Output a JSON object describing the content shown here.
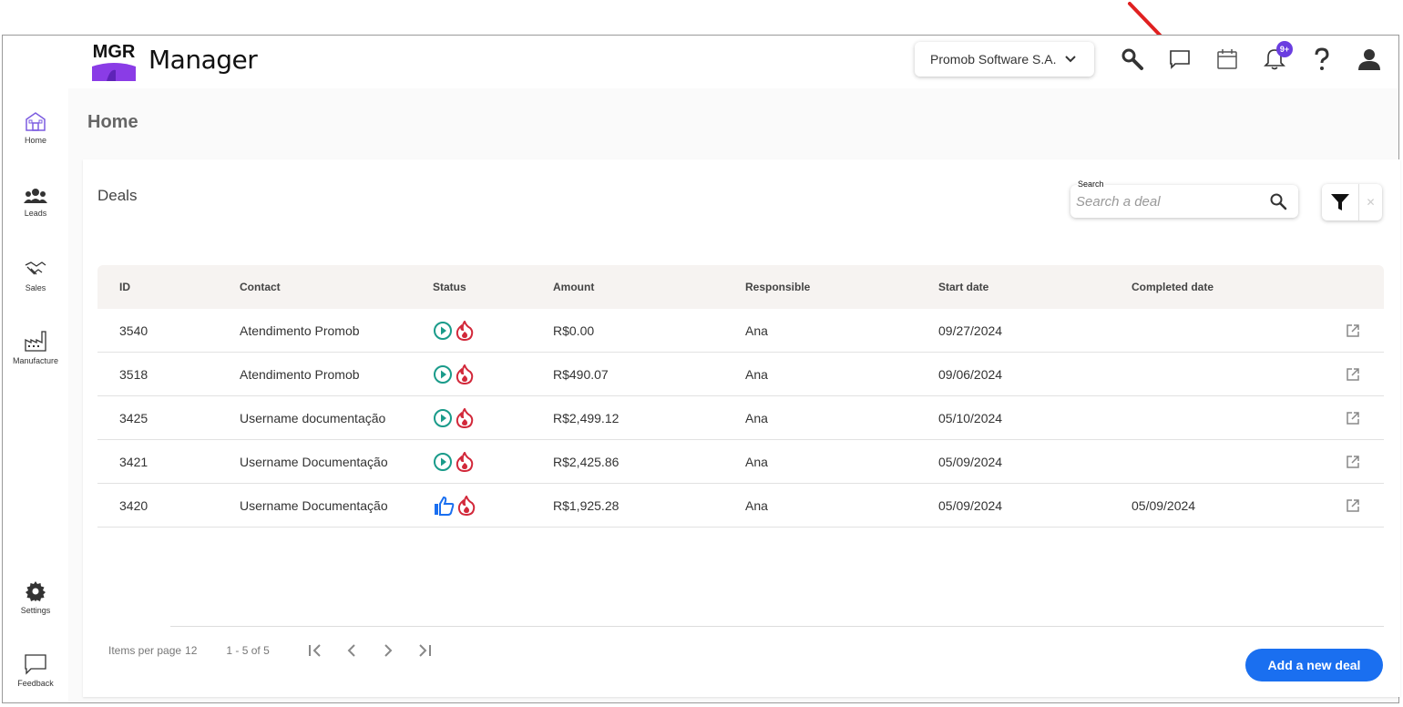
{
  "app": {
    "logo_text": "MGR",
    "name": "Manager"
  },
  "header": {
    "company": "Promob Software S.A.",
    "notifications_badge": "9+"
  },
  "sidebar": {
    "items": [
      {
        "label": "Home",
        "icon": "home-icon"
      },
      {
        "label": "Leads",
        "icon": "people-icon"
      },
      {
        "label": "Sales",
        "icon": "handshake-icon"
      },
      {
        "label": "Manufacture",
        "icon": "factory-icon"
      },
      {
        "label": "Settings",
        "icon": "gear-icon"
      },
      {
        "label": "Feedback",
        "icon": "chat-icon"
      }
    ]
  },
  "page": {
    "title": "Home"
  },
  "deals": {
    "title": "Deals",
    "search": {
      "label": "Search",
      "placeholder": "Search a deal"
    },
    "columns": {
      "id": "ID",
      "contact": "Contact",
      "status": "Status",
      "amount": "Amount",
      "responsible": "Responsible",
      "start_date": "Start date",
      "completed_date": "Completed date"
    },
    "rows": [
      {
        "id": "3540",
        "contact": "Atendimento Promob",
        "status": "in-progress",
        "amount": "R$0.00",
        "responsible": "Ana",
        "start_date": "09/27/2024",
        "completed_date": ""
      },
      {
        "id": "3518",
        "contact": "Atendimento Promob",
        "status": "in-progress",
        "amount": "R$490.07",
        "responsible": "Ana",
        "start_date": "09/06/2024",
        "completed_date": ""
      },
      {
        "id": "3425",
        "contact": "Username documentação",
        "status": "in-progress",
        "amount": "R$2,499.12",
        "responsible": "Ana",
        "start_date": "05/10/2024",
        "completed_date": ""
      },
      {
        "id": "3421",
        "contact": "Username Documentação",
        "status": "in-progress",
        "amount": "R$2,425.86",
        "responsible": "Ana",
        "start_date": "05/09/2024",
        "completed_date": ""
      },
      {
        "id": "3420",
        "contact": "Username Documentação",
        "status": "won",
        "amount": "R$1,925.28",
        "responsible": "Ana",
        "start_date": "05/09/2024",
        "completed_date": "05/09/2024"
      }
    ],
    "pagination": {
      "items_per_page_label": "Items per page",
      "items_per_page": "12",
      "range": "1 - 5 of 5"
    },
    "add_button": "Add a new deal"
  },
  "colors": {
    "accent": "#1a6ff0",
    "play": "#1a9b8a",
    "fire": "#d2283a",
    "thumb": "#1a6ff0",
    "badge": "#6a3ee0",
    "annotation": "#e02020"
  }
}
